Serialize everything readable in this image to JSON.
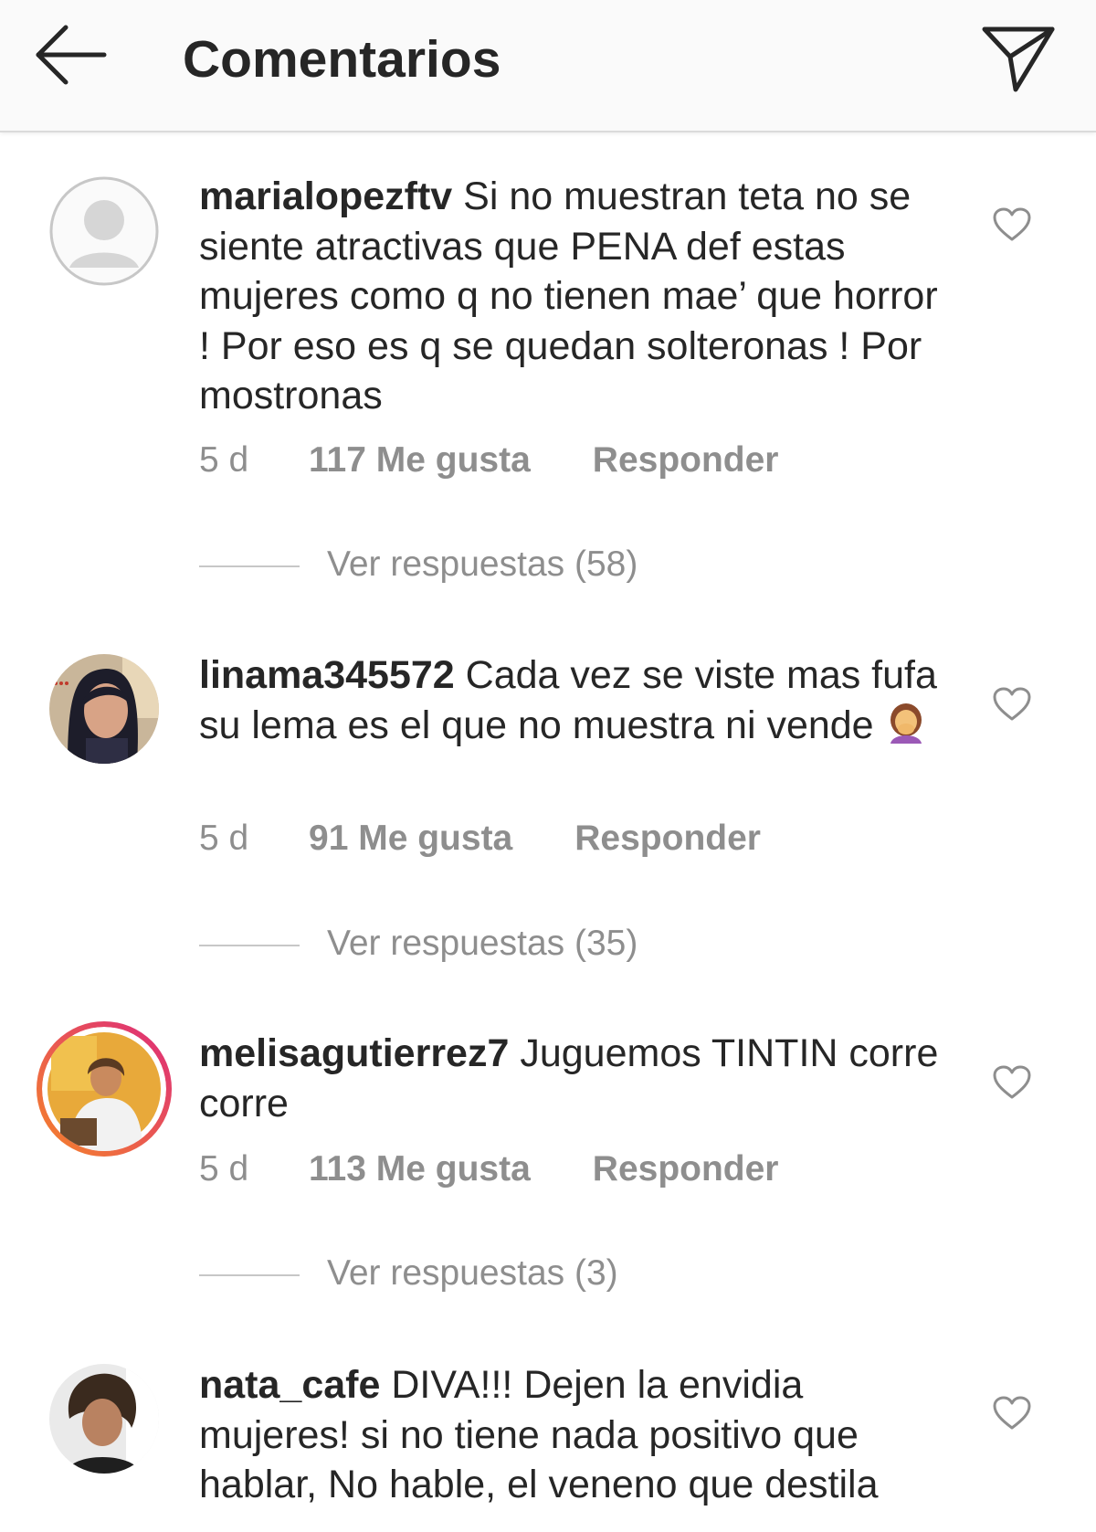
{
  "header": {
    "title": "Comentarios",
    "back_icon": "arrow-left-icon",
    "send_icon": "paper-plane-icon"
  },
  "comments": [
    {
      "username": "marialopezftv",
      "text": "Si no muestran teta no se siente atractivas que PENA def estas mujeres como q no tienen mae’ que horror ! Por eso es q se quedan solteronas ! Por mostronas",
      "time": "5 d",
      "likes": "117 Me gusta",
      "reply": "Responder",
      "view_replies": "Ver respuestas (58)"
    },
    {
      "username": "linama345572",
      "text": "Cada vez se viste mas fufa su lema es el que no muestra ni vende",
      "emoji": "facepalm-woman-emoji",
      "time": "5 d",
      "likes": "91 Me gusta",
      "reply": "Responder",
      "view_replies": "Ver respuestas (35)"
    },
    {
      "username": "melisagutierrez7",
      "text": "Juguemos TINTIN corre corre",
      "time": "5 d",
      "likes": "113 Me gusta",
      "reply": "Responder",
      "view_replies": "Ver respuestas (3)"
    },
    {
      "username": "nata_cafe",
      "text": "DIVA!!! Dejen la envidia mujeres! si no tiene nada positivo que hablar, No hable, el veneno que destila"
    }
  ],
  "colors": {
    "text": "#262626",
    "muted": "#8e8e8e",
    "header_bg": "#fafafa",
    "story_ring_start": "#f58529",
    "story_ring_end": "#dd2a7b"
  }
}
